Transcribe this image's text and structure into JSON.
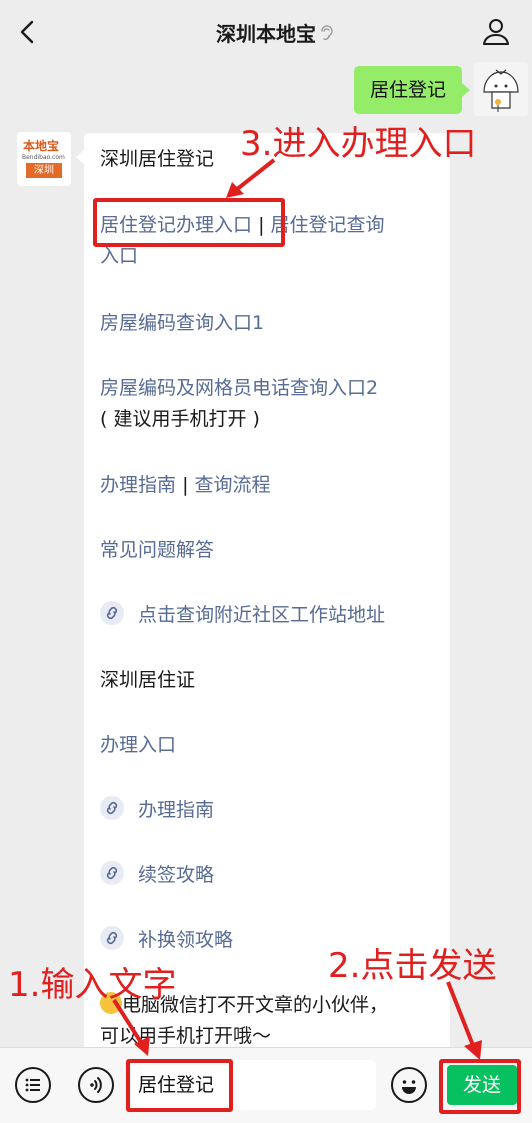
{
  "nav": {
    "title": "深圳本地宝"
  },
  "my_message": {
    "text": "居住登记"
  },
  "bot_avatar": {
    "logo_top": "本地宝",
    "logo_domain": "Bendibao.com",
    "logo_city": "深圳"
  },
  "reply": {
    "heading1": "深圳居住登记",
    "link_register": "居住登记办理入口",
    "separator": "|",
    "link_query_a": "居住登记查询",
    "link_query_b": "入口",
    "house_code1": "房屋编码查询入口1",
    "house_code2": "房屋编码及网格员电话查询入口2",
    "house_code2_note": "( 建议用手机打开 )",
    "guide": "办理指南",
    "process": "查询流程",
    "faq": "常见问题解答",
    "community": "点击查询附近社区工作站地址",
    "heading2": "深圳居住证",
    "permit_entry": "办理入口",
    "permit_guide": "办理指南",
    "renew": "续签攻略",
    "replace": "补换领攻略",
    "pc_tip_a": "电脑微信打不开文章的小伙伴，",
    "pc_tip_b": "可以用手机打开哦～"
  },
  "input": {
    "value": "居住登记"
  },
  "send": {
    "label": "发送"
  },
  "annotations": {
    "step1": "1.输入文字",
    "step2": "2.点击发送",
    "step3": "3.进入办理入口",
    "color": "#e0201f"
  }
}
